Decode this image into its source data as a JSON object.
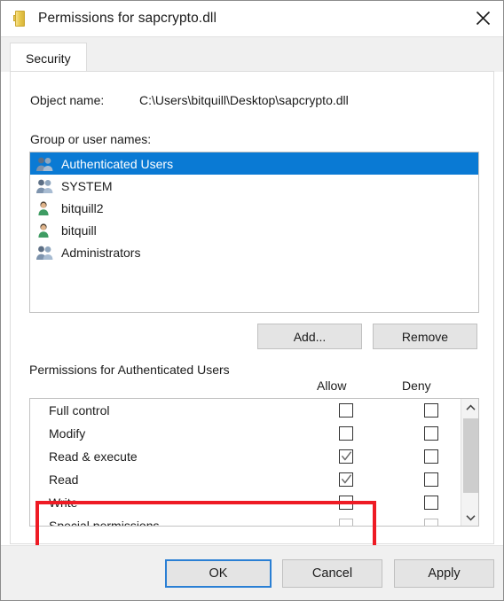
{
  "window": {
    "title": "Permissions for sapcrypto.dll",
    "icon": "key-icon",
    "close_label": "close-icon"
  },
  "tabs": [
    {
      "label": "Security",
      "active": true
    }
  ],
  "object_name": {
    "label": "Object name:",
    "value": "C:\\Users\\bitquill\\Desktop\\sapcrypto.dll"
  },
  "group_section": {
    "label": "Group or user names:",
    "items": [
      {
        "name": "Authenticated Users",
        "icon": "group-icon",
        "selected": true
      },
      {
        "name": "SYSTEM",
        "icon": "group-icon",
        "selected": false
      },
      {
        "name": "bitquill2",
        "icon": "user-icon",
        "selected": false
      },
      {
        "name": "bitquill",
        "icon": "user-icon",
        "selected": false
      },
      {
        "name": "Administrators",
        "icon": "group-icon",
        "selected": false
      }
    ],
    "add_label": "Add...",
    "remove_label": "Remove"
  },
  "permissions_section": {
    "label": "Permissions for Authenticated Users",
    "columns": [
      "Allow",
      "Deny"
    ],
    "rows": [
      {
        "name": "Full control",
        "allow": false,
        "deny": false,
        "dim": false,
        "highlighted": false
      },
      {
        "name": "Modify",
        "allow": false,
        "deny": false,
        "dim": false,
        "highlighted": false
      },
      {
        "name": "Read & execute",
        "allow": true,
        "deny": false,
        "dim": false,
        "highlighted": true
      },
      {
        "name": "Read",
        "allow": true,
        "deny": false,
        "dim": false,
        "highlighted": true
      },
      {
        "name": "Write",
        "allow": false,
        "deny": false,
        "dim": false,
        "highlighted": false
      },
      {
        "name": "Special permissions",
        "allow": false,
        "deny": false,
        "dim": true,
        "highlighted": false
      }
    ],
    "scroll_up": "chevron-up-icon",
    "scroll_down": "chevron-down-icon"
  },
  "footer": {
    "ok_label": "OK",
    "cancel_label": "Cancel",
    "apply_label": "Apply"
  },
  "colors": {
    "selection_blue": "#0a7ad4",
    "focus_blue": "#2a7fd4",
    "annotation_red": "#ee1b24",
    "chrome_gray": "#f0f0f0",
    "button_face": "#e4e4e4"
  }
}
